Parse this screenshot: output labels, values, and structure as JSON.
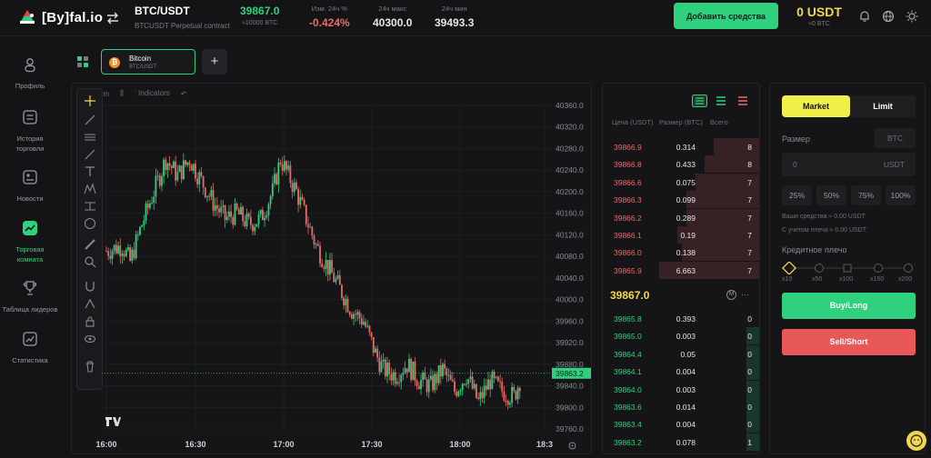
{
  "header": {
    "logo_text": "[By]fal.io",
    "pair_name": "BTC/USDT",
    "pair_sub": "BTCUSDT Perpetual contract",
    "price_value": "39867.0",
    "price_sub": "≈10000 BTC",
    "change_label": "Изм. 24ч %",
    "change_value": "-0.424%",
    "high_label": "24ч макс",
    "high_value": "40300.0",
    "low_label": "24ч мин",
    "low_value": "39493.3",
    "add_funds_label": "Добавить средства",
    "balance_value": "0 USDT",
    "balance_sub": "≈0 BTC"
  },
  "sidebar": {
    "items": [
      {
        "label": "Профиль"
      },
      {
        "label": "История торговли"
      },
      {
        "label": "Новости"
      },
      {
        "label": "Торговая комната"
      },
      {
        "label": "Таблица лидеров"
      },
      {
        "label": "Статистика"
      }
    ]
  },
  "tabs": [
    {
      "title": "Bitcoin",
      "sub": "BTC/USDT"
    }
  ],
  "chart": {
    "interval": "1m",
    "indicators_label": "Indicators",
    "current_price_tag": "39863.2",
    "x_labels": [
      "16:00",
      "16:30",
      "17:00",
      "17:30",
      "18:00",
      "18:3"
    ],
    "y_labels": [
      "40360.0",
      "40320.0",
      "40280.0",
      "40240.0",
      "40200.0",
      "40160.0",
      "40120.0",
      "40080.0",
      "40040.0",
      "40000.0",
      "39960.0",
      "39920.0",
      "39880.0",
      "39840.0",
      "39800.0",
      "39760.0"
    ]
  },
  "orderbook": {
    "col_price": "Цена (USDT)",
    "col_size": "Размер (BTC)",
    "col_total": "Всего",
    "asks": [
      {
        "price": "39866.9",
        "size": "0.314",
        "total": "8"
      },
      {
        "price": "39866.8",
        "size": "0.433",
        "total": "8"
      },
      {
        "price": "39866.6",
        "size": "0.075",
        "total": "7"
      },
      {
        "price": "39866.3",
        "size": "0.099",
        "total": "7"
      },
      {
        "price": "39866.2",
        "size": "0.289",
        "total": "7"
      },
      {
        "price": "39866.1",
        "size": "0.19",
        "total": "7"
      },
      {
        "price": "39866.0",
        "size": "0.138",
        "total": "7"
      },
      {
        "price": "39865.9",
        "size": "6.663",
        "total": "7"
      }
    ],
    "mid_price": "39867.0",
    "bids": [
      {
        "price": "39865.8",
        "size": "0.393",
        "total": "0"
      },
      {
        "price": "39865.0",
        "size": "0.003",
        "total": "0"
      },
      {
        "price": "39864.4",
        "size": "0.05",
        "total": "0"
      },
      {
        "price": "39864.1",
        "size": "0.004",
        "total": "0"
      },
      {
        "price": "39864.0",
        "size": "0.003",
        "total": "0"
      },
      {
        "price": "39863.6",
        "size": "0.014",
        "total": "0"
      },
      {
        "price": "39863.4",
        "size": "0.004",
        "total": "0"
      },
      {
        "price": "39863.2",
        "size": "0.078",
        "total": "1"
      }
    ]
  },
  "order_panel": {
    "market_label": "Market",
    "limit_label": "Limit",
    "size_label": "Размер",
    "size_unit": "BTC",
    "amount_value": "0",
    "amount_unit": "USDT",
    "pcts": [
      "25%",
      "50%",
      "75%",
      "100%"
    ],
    "funds_text": "Ваши средства ≈ 0.00 USDT",
    "with_leverage_text": "С учетом плеча ≈ 0.00 USDT",
    "leverage_label": "Кредитное плечо",
    "leverage_marks": [
      "x10",
      "x50",
      "x100",
      "x150",
      "x200"
    ],
    "buy_label": "Buy/Long",
    "sell_label": "Sell/Short"
  },
  "colors": {
    "green": "#2fd17e",
    "red": "#e96a6a",
    "yellow": "#f1d74b",
    "bg": "#141416"
  }
}
